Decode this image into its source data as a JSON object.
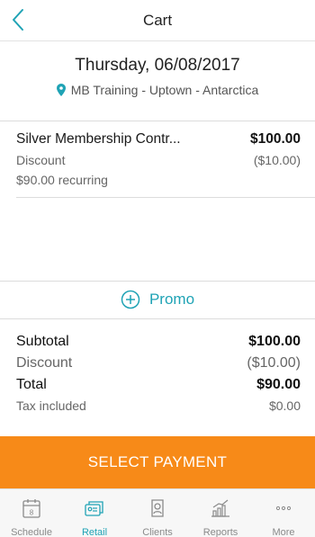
{
  "header": {
    "title": "Cart",
    "back_icon": "chevron-left-icon"
  },
  "booking": {
    "date": "Thursday, 06/08/2017",
    "location": "MB Training - Uptown - Antarctica",
    "location_icon": "location-pin-icon"
  },
  "cart_item": {
    "name": "Silver Membership Contr...",
    "price": "$100.00",
    "discount_label": "Discount",
    "discount_value": "($10.00)",
    "recurring_text": "$90.00 recurring"
  },
  "promo": {
    "label": "Promo",
    "icon": "plus-circle-icon"
  },
  "summary": {
    "subtotal_label": "Subtotal",
    "subtotal_value": "$100.00",
    "discount_label": "Discount",
    "discount_value": "($10.00)",
    "total_label": "Total",
    "total_value": "$90.00",
    "tax_label": "Tax included",
    "tax_value": "$0.00"
  },
  "payment_button": {
    "label": "SELECT PAYMENT"
  },
  "tabbar": {
    "active": "Retail",
    "tabs": [
      {
        "label": "Schedule",
        "icon": "calendar-icon"
      },
      {
        "label": "Retail",
        "icon": "retail-icon"
      },
      {
        "label": "Clients",
        "icon": "client-icon"
      },
      {
        "label": "Reports",
        "icon": "reports-chart-icon"
      },
      {
        "label": "More",
        "icon": "more-dots-icon"
      }
    ]
  },
  "colors": {
    "accent": "#1fa3b5",
    "primary_button": "#f78a18",
    "text": "#1a1a1a",
    "muted": "#666666"
  }
}
